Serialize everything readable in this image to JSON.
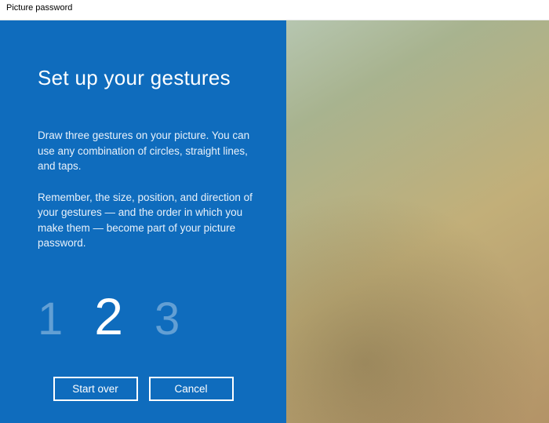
{
  "window": {
    "title": "Picture password"
  },
  "panel": {
    "heading": "Set up your gestures",
    "paragraph1": "Draw three gestures on your picture. You can use any combination of circles, straight lines, and taps.",
    "paragraph2": "Remember, the size, position, and direction of your gestures — and the order in which you make them — become part of your picture password."
  },
  "steps": {
    "s1": "1",
    "s2": "2",
    "s3": "3",
    "active": 2
  },
  "buttons": {
    "start_over": "Start over",
    "cancel": "Cancel"
  }
}
